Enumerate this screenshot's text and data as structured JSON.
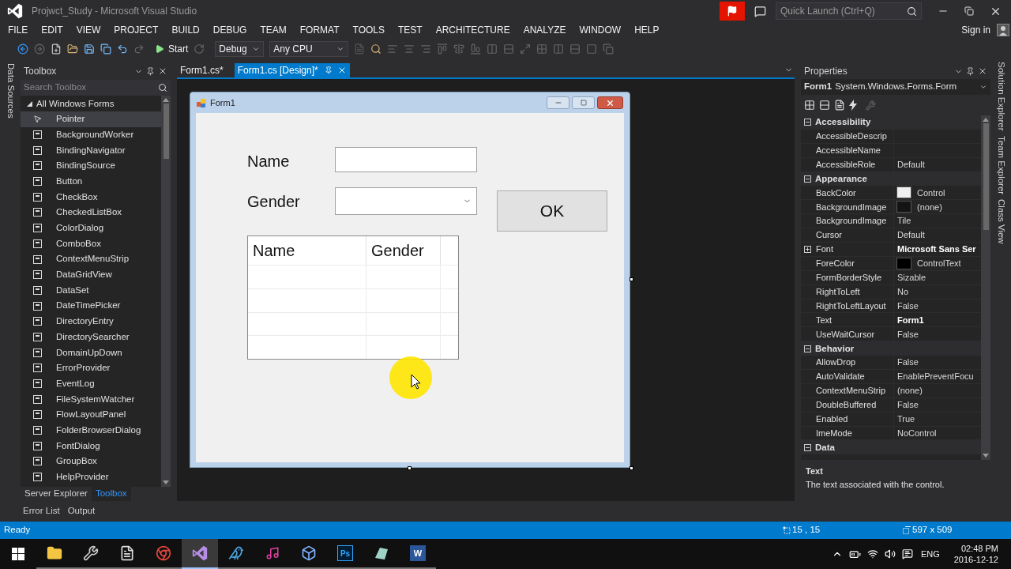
{
  "window": {
    "title": "Projwct_Study - Microsoft Visual Studio",
    "quick_launch": {
      "placeholder": "Quick Launch (Ctrl+Q)"
    },
    "sign_in": "Sign in"
  },
  "menu": [
    "FILE",
    "EDIT",
    "VIEW",
    "PROJECT",
    "BUILD",
    "DEBUG",
    "TEAM",
    "FORMAT",
    "TOOLS",
    "TEST",
    "ARCHITECTURE",
    "ANALYZE",
    "WINDOW",
    "HELP"
  ],
  "toolbar": {
    "start": "Start",
    "configuration": "Debug",
    "platform": "Any CPU"
  },
  "left_side_tabs": [
    "Data Sources"
  ],
  "toolbox": {
    "title": "Toolbox",
    "search": {
      "placeholder": "Search Toolbox"
    },
    "group": {
      "label": "All Windows Forms",
      "expanded": true
    },
    "items": [
      {
        "label": "Pointer",
        "selected": true
      },
      {
        "label": "BackgroundWorker",
        "selected": false
      },
      {
        "label": "BindingNavigator",
        "selected": false
      },
      {
        "label": "BindingSource",
        "selected": false
      },
      {
        "label": "Button",
        "selected": false
      },
      {
        "label": "CheckBox",
        "selected": false
      },
      {
        "label": "CheckedListBox",
        "selected": false
      },
      {
        "label": "ColorDialog",
        "selected": false
      },
      {
        "label": "ComboBox",
        "selected": false
      },
      {
        "label": "ContextMenuStrip",
        "selected": false
      },
      {
        "label": "DataGridView",
        "selected": false
      },
      {
        "label": "DataSet",
        "selected": false
      },
      {
        "label": "DateTimePicker",
        "selected": false
      },
      {
        "label": "DirectoryEntry",
        "selected": false
      },
      {
        "label": "DirectorySearcher",
        "selected": false
      },
      {
        "label": "DomainUpDown",
        "selected": false
      },
      {
        "label": "ErrorProvider",
        "selected": false
      },
      {
        "label": "EventLog",
        "selected": false
      },
      {
        "label": "FileSystemWatcher",
        "selected": false
      },
      {
        "label": "FlowLayoutPanel",
        "selected": false
      },
      {
        "label": "FolderBrowserDialog",
        "selected": false
      },
      {
        "label": "FontDialog",
        "selected": false
      },
      {
        "label": "GroupBox",
        "selected": false
      },
      {
        "label": "HelpProvider",
        "selected": false
      }
    ],
    "bottom_tabs": [
      {
        "label": "Server Explorer",
        "selected": false
      },
      {
        "label": "Toolbox",
        "selected": true
      }
    ]
  },
  "document_tabs": [
    {
      "label": "Form1.cs*",
      "selected": false
    },
    {
      "label": "Form1.cs [Design]*",
      "selected": true
    }
  ],
  "form": {
    "title": "Form1",
    "name_label": "Name",
    "gender_label": "Gender",
    "ok_button": "OK",
    "grid_columns": [
      "Name",
      "Gender"
    ]
  },
  "properties": {
    "title": "Properties",
    "object_name": "Form1",
    "object_type": "System.Windows.Forms.Form",
    "categories": [
      {
        "name": "Accessibility",
        "expanded": true,
        "props": [
          {
            "name": "AccessibleDescrip"
          },
          {
            "name": "AccessibleName"
          },
          {
            "name": "AccessibleRole",
            "value": "Default",
            "modified": false
          }
        ]
      },
      {
        "name": "Appearance",
        "expanded": true,
        "props": [
          {
            "name": "BackColor",
            "value": "Control",
            "modified": false,
            "kind": "color",
            "color": "#f0f0f0"
          },
          {
            "name": "BackgroundImage",
            "value": "(none)",
            "modified": false,
            "kind": "color",
            "color": "#141414"
          },
          {
            "name": "BackgroundImage",
            "value": "Tile",
            "modified": false
          },
          {
            "name": "Cursor",
            "value": "Default",
            "modified": false
          },
          {
            "name": "Font",
            "value": "Microsoft Sans Ser",
            "modified": true,
            "kind": "group",
            "expanded": false
          },
          {
            "name": "ForeColor",
            "value": "ControlText",
            "modified": false,
            "kind": "color",
            "color": "#000000"
          },
          {
            "name": "FormBorderStyle",
            "value": "Sizable",
            "modified": false
          },
          {
            "name": "RightToLeft",
            "value": "No",
            "modified": false
          },
          {
            "name": "RightToLeftLayout",
            "value": "False",
            "modified": false
          },
          {
            "name": "Text",
            "value": "Form1",
            "modified": true
          },
          {
            "name": "UseWaitCursor",
            "value": "False",
            "modified": false
          }
        ]
      },
      {
        "name": "Behavior",
        "expanded": true,
        "props": [
          {
            "name": "AllowDrop",
            "value": "False",
            "modified": false
          },
          {
            "name": "AutoValidate",
            "value": "EnablePreventFocu",
            "modified": false
          },
          {
            "name": "ContextMenuStrip",
            "value": "(none)",
            "modified": false
          },
          {
            "name": "DoubleBuffered",
            "value": "False",
            "modified": false
          },
          {
            "name": "Enabled",
            "value": "True",
            "modified": false
          },
          {
            "name": "ImeMode",
            "value": "NoControl",
            "modified": false
          }
        ]
      },
      {
        "name": "Data",
        "expanded": true
      }
    ],
    "description": {
      "title": "Text",
      "text": "The text associated with the control."
    }
  },
  "right_side_tabs": [
    "Solution Explorer",
    "Team Explorer",
    "Class View"
  ],
  "output_tabs": [
    "Error List",
    "Output"
  ],
  "status_bar": {
    "text": "Ready",
    "position": "15 , 15",
    "size": "597 x 509"
  },
  "taskbar": {
    "apps": [
      {
        "kind": "folder",
        "selected": false
      },
      {
        "kind": "tools",
        "selected": false
      },
      {
        "kind": "notepad",
        "selected": false
      },
      {
        "kind": "chrome",
        "selected": false
      },
      {
        "kind": "studio",
        "selected": true
      },
      {
        "kind": "bird",
        "selected": false
      },
      {
        "kind": "music",
        "selected": false
      },
      {
        "kind": "cube",
        "selected": false
      },
      {
        "kind": "ps",
        "label": "Ps",
        "selected": false
      },
      {
        "kind": "glass",
        "selected": false
      },
      {
        "kind": "word",
        "label": "W",
        "selected": false
      }
    ],
    "language": "ENG",
    "time": "02:48 PM",
    "date": "2016-12-12"
  }
}
